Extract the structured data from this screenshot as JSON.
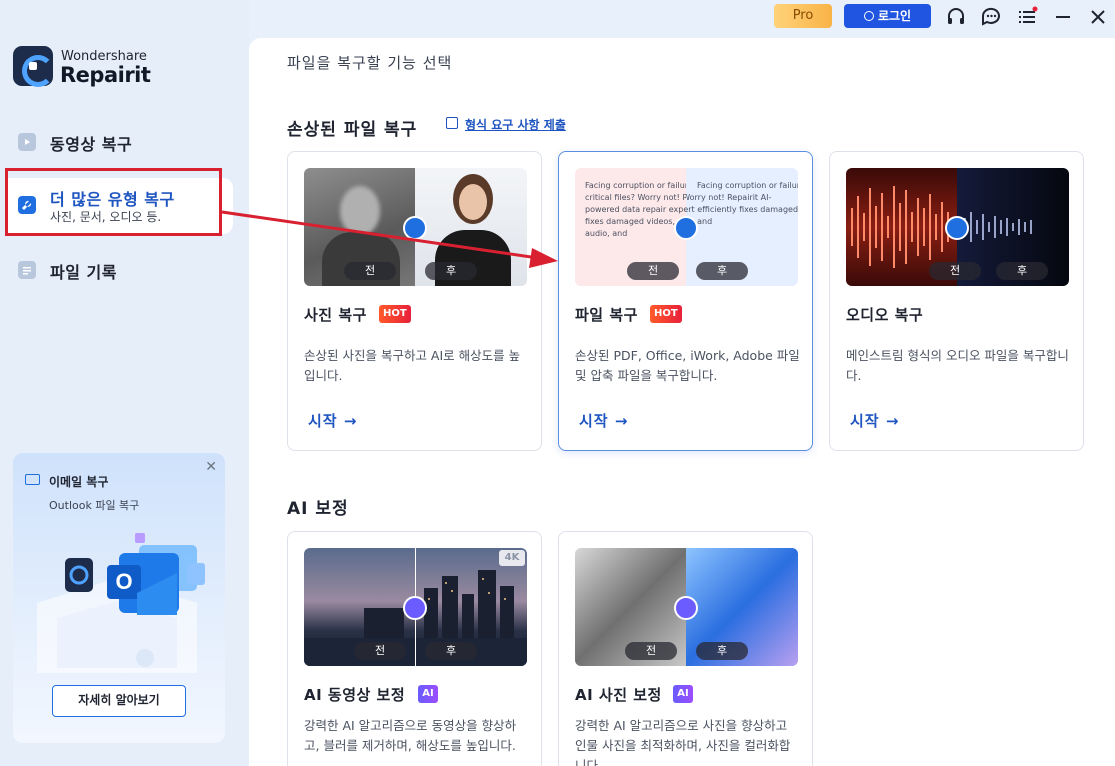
{
  "app": {
    "brand_top": "Wondershare",
    "brand_main": "Repairit"
  },
  "sidebar": {
    "items": [
      {
        "label": "동영상 복구"
      },
      {
        "label": "더 많은 유형 복구",
        "sub": "사진, 문서, 오디오 등."
      },
      {
        "label": "파일 기록"
      }
    ],
    "promo": {
      "title": "이메일 복구",
      "subtitle": "Outlook 파일 복구",
      "button": "자세히 알아보기"
    }
  },
  "topbar": {
    "pro_label": "Pro",
    "login_label": "로그인"
  },
  "main": {
    "page_title": "파일을 복구할 기능 선택",
    "damaged_section": {
      "title": "손상된 파일 복구",
      "link": "형식 요구 사항 제출",
      "cards": [
        {
          "title": "사진 복구",
          "badge": "HOT",
          "desc": "손상된 사진을 복구하고 AI로 해상도를 높입니다.",
          "action": "시작 →",
          "before": "전",
          "after": "후"
        },
        {
          "title": "파일 복구",
          "badge": "HOT",
          "desc": "손상된 PDF, Office, iWork, Adobe 파일 및 압축 파일을 복구합니다.",
          "action": "시작 →",
          "before": "전",
          "after": "후",
          "doc_text": "Facing corruption or failure in opening critical files? Worry not! Repairit AI-powered data repair expert efficiently fixes damaged videos, photos, files, audio, and"
        },
        {
          "title": "오디오 복구",
          "badge": "",
          "desc": "메인스트림 형식의 오디오 파일을 복구합니다.",
          "action": "시작 →",
          "before": "전",
          "after": "후"
        }
      ]
    },
    "ai_section": {
      "title": "AI 보정",
      "cards": [
        {
          "title": "AI 동영상 보정",
          "badge": "AI",
          "desc": "강력한 AI 알고리즘으로 동영상을 향상하고, 블러를 제거하며, 해상도를 높입니다.",
          "before": "전",
          "after": "후",
          "corner": "4K"
        },
        {
          "title": "AI 사진 보정",
          "badge": "AI",
          "desc": "강력한 AI 알고리즘으로 사진을 향상하고 인물 사진을 최적화하며, 사진을 컬러화합니다.",
          "before": "전",
          "after": "후"
        }
      ]
    }
  },
  "colors": {
    "accent": "#1f55e0",
    "annotation": "#d82030",
    "hot": "#e8203a",
    "ai": "#7a54ff"
  }
}
